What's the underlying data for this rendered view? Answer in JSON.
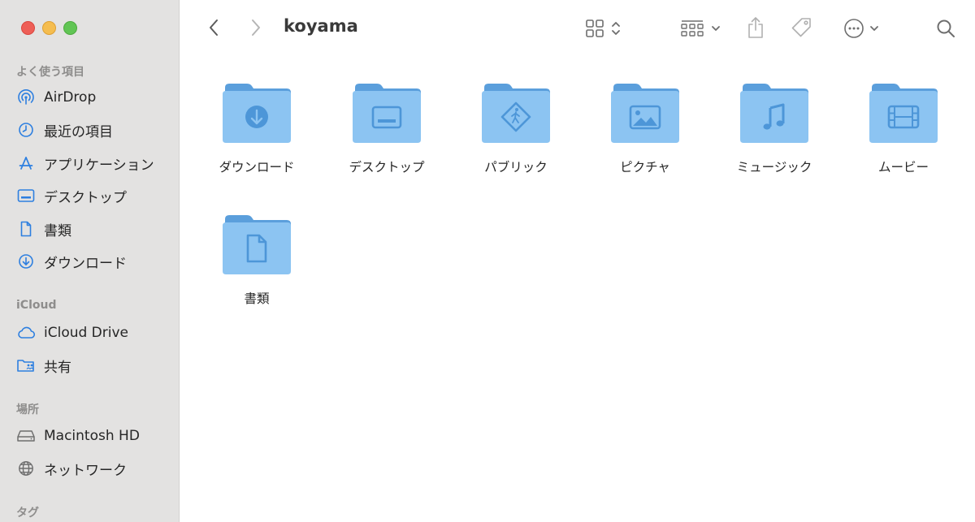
{
  "window": {
    "title": "koyama"
  },
  "sidebar": {
    "sections": [
      {
        "title": "よく使う項目",
        "items": [
          {
            "label": "AirDrop",
            "icon": "airdrop-icon"
          },
          {
            "label": "最近の項目",
            "icon": "clock-icon"
          },
          {
            "label": "アプリケーション",
            "icon": "applications-icon"
          },
          {
            "label": "デスクトップ",
            "icon": "desktop-icon"
          },
          {
            "label": "書類",
            "icon": "document-icon"
          },
          {
            "label": "ダウンロード",
            "icon": "download-icon"
          }
        ]
      },
      {
        "title": "iCloud",
        "items": [
          {
            "label": "iCloud Drive",
            "icon": "cloud-icon"
          },
          {
            "label": "共有",
            "icon": "shared-folder-icon"
          }
        ]
      },
      {
        "title": "場所",
        "items": [
          {
            "label": "Macintosh HD",
            "icon": "disk-icon"
          },
          {
            "label": "ネットワーク",
            "icon": "globe-icon"
          }
        ]
      },
      {
        "title": "タグ",
        "items": []
      }
    ]
  },
  "toolbar": {
    "back_icon": "chevron-left-icon",
    "forward_icon": "chevron-right-icon",
    "view_icon": "grid-view-icon",
    "group_icon": "group-view-icon",
    "share_icon": "share-icon",
    "tag_icon": "tag-icon",
    "more_icon": "ellipsis-circle-icon",
    "search_icon": "search-icon"
  },
  "folders": [
    {
      "label": "ダウンロード",
      "glyph": "download"
    },
    {
      "label": "デスクトップ",
      "glyph": "desktop"
    },
    {
      "label": "パブリック",
      "glyph": "public"
    },
    {
      "label": "ピクチャ",
      "glyph": "pictures"
    },
    {
      "label": "ミュージック",
      "glyph": "music"
    },
    {
      "label": "ムービー",
      "glyph": "movies"
    },
    {
      "label": "書類",
      "glyph": "documents"
    }
  ],
  "colors": {
    "sidebar_bg": "#e3e2e1",
    "accent": "#2d7fe0",
    "folder_back": "#5b9fdc",
    "folder_front": "#8cc4f2",
    "folder_glyph": "#4d96d8"
  }
}
